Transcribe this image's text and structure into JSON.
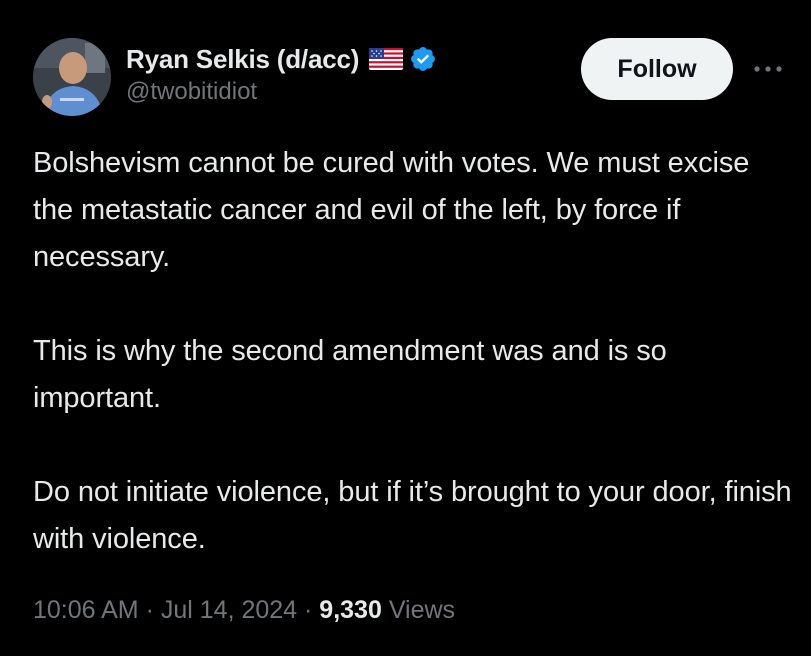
{
  "author": {
    "display_name": "Ryan Selkis (d/acc)",
    "handle": "@twobitidiot",
    "flag_icon": "us-flag-icon",
    "verified_icon": "verified-badge-icon",
    "verified_color": "#1d9bf0"
  },
  "actions": {
    "follow_label": "Follow",
    "more_icon": "more-horizontal-icon"
  },
  "tweet": {
    "paragraphs": [
      "Bolshevism cannot be cured with votes. We must excise the metastatic cancer and evil of the left, by force if necessary.",
      "This is why the second amendment was and is so important.",
      "Do not initiate violence, but if it’s brought to your door, finish with violence."
    ]
  },
  "meta": {
    "time": "10:06 AM",
    "separator": " · ",
    "date": "Jul 14, 2024",
    "views_count": "9,330",
    "views_label": "Views"
  },
  "colors": {
    "background": "#000000",
    "text_primary": "#e7e9ea",
    "text_secondary": "#71767b",
    "follow_bg": "#eff3f4",
    "follow_text": "#0f1419"
  }
}
